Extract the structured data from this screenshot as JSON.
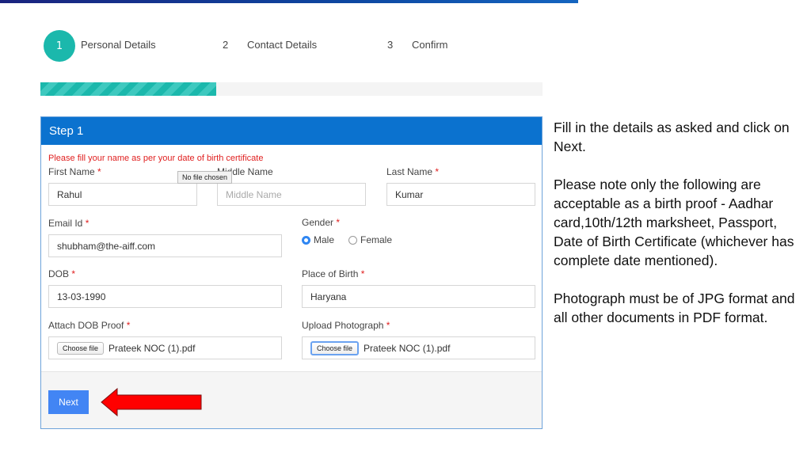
{
  "wizard": {
    "steps": [
      {
        "number": "1",
        "label": "Personal Details",
        "active": true
      },
      {
        "number": "2",
        "label": "Contact Details",
        "active": false
      },
      {
        "number": "3",
        "label": "Confirm",
        "active": false
      }
    ],
    "progress_fraction": 0.35
  },
  "panel": {
    "title": "Step 1",
    "notice": "Please fill your name as per your date of birth certificate",
    "required_marker": "*",
    "tooltip": "No file chosen",
    "fields": {
      "first_name": {
        "label": "First Name",
        "value": "Rahul"
      },
      "middle_name": {
        "label": "Middle Name",
        "placeholder": "Middle Name"
      },
      "last_name": {
        "label": "Last Name",
        "value": "Kumar"
      },
      "email": {
        "label": "Email Id",
        "value": "shubham@the-aiff.com"
      },
      "gender": {
        "label": "Gender",
        "options": [
          "Male",
          "Female"
        ],
        "selected": "Male"
      },
      "dob": {
        "label": "DOB",
        "value": "13-03-1990"
      },
      "place_of_birth": {
        "label": "Place of Birth",
        "value": "Haryana"
      },
      "dob_proof": {
        "label": "Attach DOB Proof",
        "button": "Choose file",
        "file": "Prateek NOC (1).pdf"
      },
      "photograph": {
        "label": "Upload Photograph",
        "button": "Choose file",
        "file": "Prateek NOC (1).pdf"
      }
    },
    "next_label": "Next"
  },
  "annotation": {
    "arrow_color": "#ff0000"
  },
  "help": {
    "paragraphs": [
      "Fill in the details as asked and click on Next.",
      "Please note only the following are acceptable as a birth proof - Aadhar card,10th/12th marksheet, Passport, Date of Birth Certificate (whichever has complete date mentioned).",
      "Photograph must be of JPG format and all other documents in PDF format."
    ]
  }
}
